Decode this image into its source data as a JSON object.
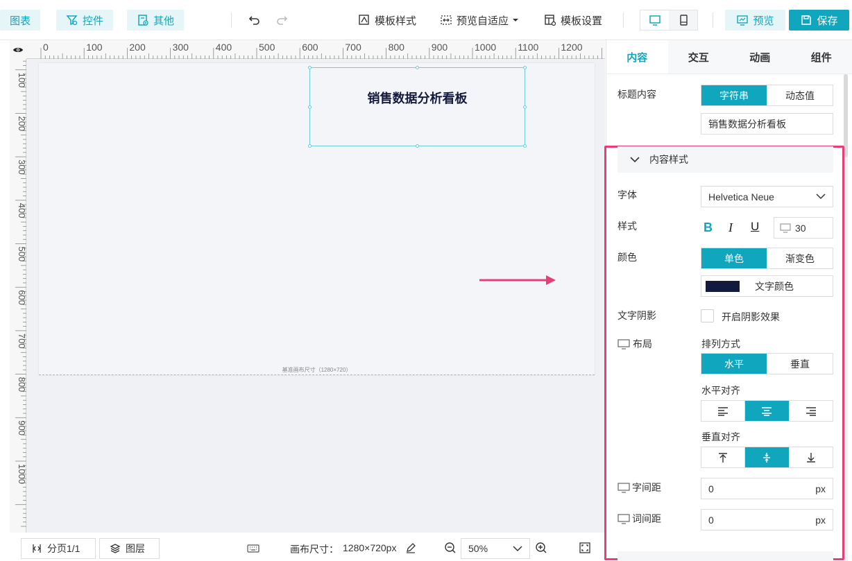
{
  "toolbar": {
    "chart_label": "图表",
    "control_label": "控件",
    "other_label": "其他",
    "template_style_label": "模板样式",
    "preview_adapt_label": "预览自适应",
    "template_settings_label": "模板设置",
    "preview_label": "预览",
    "save_label": "保存"
  },
  "ruler": {
    "top_ticks": [
      "0",
      "100",
      "200",
      "300",
      "400",
      "500",
      "600",
      "700",
      "800",
      "900",
      "1000",
      "1100",
      "1200"
    ],
    "left_ticks": [
      "100",
      "200",
      "300",
      "400",
      "500",
      "600",
      "700",
      "800",
      "900",
      "1000"
    ]
  },
  "canvas": {
    "title_text": "销售数据分析看板",
    "caption": "基准画布尺寸（1280×720）"
  },
  "statusbar": {
    "page_label": "分页1/1",
    "layer_label": "图层",
    "canvas_size_label": "画布尺寸：",
    "canvas_size_value": "1280×720px",
    "zoom_value": "50%"
  },
  "panel": {
    "tabs": [
      "内容",
      "交互",
      "动画",
      "组件"
    ],
    "title_content_label": "标题内容",
    "title_mode_options": [
      "字符串",
      "动态值"
    ],
    "title_text_value": "销售数据分析看板",
    "content_style_label": "内容样式",
    "font_label": "字体",
    "font_value": "Helvetica Neue",
    "style_label": "样式",
    "font_size_value": "30",
    "color_label": "颜色",
    "color_mode_options": [
      "单色",
      "渐变色"
    ],
    "text_color_label": "文字颜色",
    "text_color_swatch": "#141a3d",
    "shadow_label": "文字阴影",
    "shadow_checkbox_label": "开启阴影效果",
    "layout_label": "布局",
    "arrange_label": "排列方式",
    "arrange_options": [
      "水平",
      "垂直"
    ],
    "h_align_label": "水平对齐",
    "v_align_label": "垂直对齐",
    "letter_spacing_label": "字间距",
    "letter_spacing_value": "0",
    "word_spacing_label": "词间距",
    "word_spacing_value": "0",
    "unit_px": "px"
  },
  "colors": {
    "accent": "#10a6bd",
    "highlight_border": "#e83e78",
    "arrow": "#e83e78"
  }
}
